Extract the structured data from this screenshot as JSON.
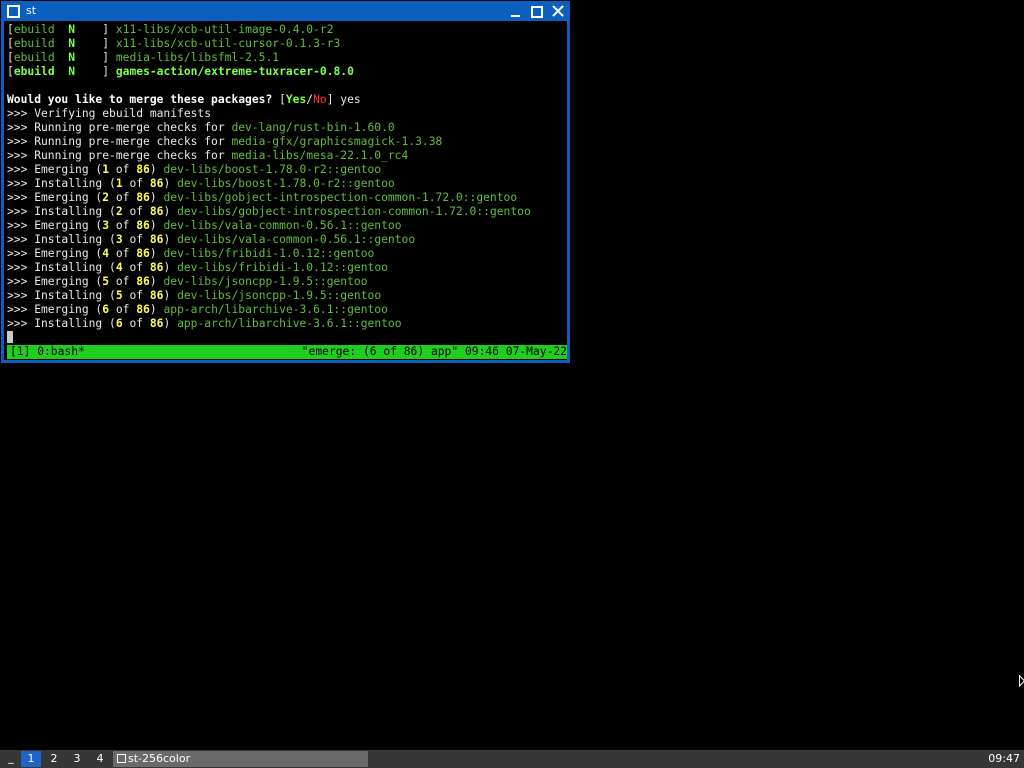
{
  "window": {
    "title": "st",
    "minimize_icon": "minimize-icon",
    "maximize_icon": "maximize-icon",
    "close_icon": "close-icon"
  },
  "terminal": {
    "lines": [
      [
        {
          "t": "[",
          "c": ""
        },
        {
          "t": "ebuild",
          "c": "g"
        },
        {
          "t": "  ",
          "c": ""
        },
        {
          "t": "N",
          "c": "gb"
        },
        {
          "t": "    ] ",
          "c": ""
        },
        {
          "t": "x11-libs/xcb-util-image-0.4.0-r2",
          "c": "g"
        }
      ],
      [
        {
          "t": "[",
          "c": ""
        },
        {
          "t": "ebuild",
          "c": "g"
        },
        {
          "t": "  ",
          "c": ""
        },
        {
          "t": "N",
          "c": "gb"
        },
        {
          "t": "    ] ",
          "c": ""
        },
        {
          "t": "x11-libs/xcb-util-cursor-0.1.3-r3",
          "c": "g"
        }
      ],
      [
        {
          "t": "[",
          "c": ""
        },
        {
          "t": "ebuild",
          "c": "g"
        },
        {
          "t": "  ",
          "c": ""
        },
        {
          "t": "N",
          "c": "gb"
        },
        {
          "t": "    ] ",
          "c": ""
        },
        {
          "t": "media-libs/libsfml-2.5.1",
          "c": "g"
        }
      ],
      [
        {
          "t": "[",
          "c": ""
        },
        {
          "t": "ebuild",
          "c": "gb"
        },
        {
          "t": "  ",
          "c": ""
        },
        {
          "t": "N",
          "c": "gb"
        },
        {
          "t": "    ] ",
          "c": ""
        },
        {
          "t": "games-action/extreme-tuxracer-0.8.0",
          "c": "gb"
        }
      ],
      [
        {
          "t": "",
          "c": ""
        }
      ],
      [
        {
          "t": "Would you like to merge these packages?",
          "c": "w"
        },
        {
          "t": " [",
          "c": ""
        },
        {
          "t": "Yes",
          "c": "gb"
        },
        {
          "t": "/",
          "c": ""
        },
        {
          "t": "No",
          "c": "r"
        },
        {
          "t": "] yes",
          "c": ""
        }
      ],
      [
        {
          "t": ">>> Verifying ebuild manifests",
          "c": ""
        }
      ],
      [
        {
          "t": ">>> Running pre-merge checks for ",
          "c": ""
        },
        {
          "t": "dev-lang/rust-bin-1.60.0",
          "c": "g"
        }
      ],
      [
        {
          "t": ">>> Running pre-merge checks for ",
          "c": ""
        },
        {
          "t": "media-gfx/graphicsmagick-1.3.38",
          "c": "g"
        }
      ],
      [
        {
          "t": ">>> Running pre-merge checks for ",
          "c": ""
        },
        {
          "t": "media-libs/mesa-22.1.0_rc4",
          "c": "g"
        }
      ],
      [
        {
          "t": ">>> Emerging (",
          "c": ""
        },
        {
          "t": "1",
          "c": "y"
        },
        {
          "t": " of ",
          "c": ""
        },
        {
          "t": "86",
          "c": "y"
        },
        {
          "t": ") ",
          "c": ""
        },
        {
          "t": "dev-libs/boost-1.78.0-r2::gentoo",
          "c": "g"
        }
      ],
      [
        {
          "t": ">>> Installing (",
          "c": ""
        },
        {
          "t": "1",
          "c": "y"
        },
        {
          "t": " of ",
          "c": ""
        },
        {
          "t": "86",
          "c": "y"
        },
        {
          "t": ") ",
          "c": ""
        },
        {
          "t": "dev-libs/boost-1.78.0-r2::gentoo",
          "c": "g"
        }
      ],
      [
        {
          "t": ">>> Emerging (",
          "c": ""
        },
        {
          "t": "2",
          "c": "y"
        },
        {
          "t": " of ",
          "c": ""
        },
        {
          "t": "86",
          "c": "y"
        },
        {
          "t": ") ",
          "c": ""
        },
        {
          "t": "dev-libs/gobject-introspection-common-1.72.0::gentoo",
          "c": "g"
        }
      ],
      [
        {
          "t": ">>> Installing (",
          "c": ""
        },
        {
          "t": "2",
          "c": "y"
        },
        {
          "t": " of ",
          "c": ""
        },
        {
          "t": "86",
          "c": "y"
        },
        {
          "t": ") ",
          "c": ""
        },
        {
          "t": "dev-libs/gobject-introspection-common-1.72.0::gentoo",
          "c": "g"
        }
      ],
      [
        {
          "t": ">>> Emerging (",
          "c": ""
        },
        {
          "t": "3",
          "c": "y"
        },
        {
          "t": " of ",
          "c": ""
        },
        {
          "t": "86",
          "c": "y"
        },
        {
          "t": ") ",
          "c": ""
        },
        {
          "t": "dev-libs/vala-common-0.56.1::gentoo",
          "c": "g"
        }
      ],
      [
        {
          "t": ">>> Installing (",
          "c": ""
        },
        {
          "t": "3",
          "c": "y"
        },
        {
          "t": " of ",
          "c": ""
        },
        {
          "t": "86",
          "c": "y"
        },
        {
          "t": ") ",
          "c": ""
        },
        {
          "t": "dev-libs/vala-common-0.56.1::gentoo",
          "c": "g"
        }
      ],
      [
        {
          "t": ">>> Emerging (",
          "c": ""
        },
        {
          "t": "4",
          "c": "y"
        },
        {
          "t": " of ",
          "c": ""
        },
        {
          "t": "86",
          "c": "y"
        },
        {
          "t": ") ",
          "c": ""
        },
        {
          "t": "dev-libs/fribidi-1.0.12::gentoo",
          "c": "g"
        }
      ],
      [
        {
          "t": ">>> Installing (",
          "c": ""
        },
        {
          "t": "4",
          "c": "y"
        },
        {
          "t": " of ",
          "c": ""
        },
        {
          "t": "86",
          "c": "y"
        },
        {
          "t": ") ",
          "c": ""
        },
        {
          "t": "dev-libs/fribidi-1.0.12::gentoo",
          "c": "g"
        }
      ],
      [
        {
          "t": ">>> Emerging (",
          "c": ""
        },
        {
          "t": "5",
          "c": "y"
        },
        {
          "t": " of ",
          "c": ""
        },
        {
          "t": "86",
          "c": "y"
        },
        {
          "t": ") ",
          "c": ""
        },
        {
          "t": "dev-libs/jsoncpp-1.9.5::gentoo",
          "c": "g"
        }
      ],
      [
        {
          "t": ">>> Installing (",
          "c": ""
        },
        {
          "t": "5",
          "c": "y"
        },
        {
          "t": " of ",
          "c": ""
        },
        {
          "t": "86",
          "c": "y"
        },
        {
          "t": ") ",
          "c": ""
        },
        {
          "t": "dev-libs/jsoncpp-1.9.5::gentoo",
          "c": "g"
        }
      ],
      [
        {
          "t": ">>> Emerging (",
          "c": ""
        },
        {
          "t": "6",
          "c": "y"
        },
        {
          "t": " of ",
          "c": ""
        },
        {
          "t": "86",
          "c": "y"
        },
        {
          "t": ") ",
          "c": ""
        },
        {
          "t": "app-arch/libarchive-3.6.1::gentoo",
          "c": "g"
        }
      ],
      [
        {
          "t": ">>> Installing (",
          "c": ""
        },
        {
          "t": "6",
          "c": "y"
        },
        {
          "t": " of ",
          "c": ""
        },
        {
          "t": "86",
          "c": "y"
        },
        {
          "t": ") ",
          "c": ""
        },
        {
          "t": "app-arch/libarchive-3.6.1::gentoo",
          "c": "g"
        }
      ]
    ]
  },
  "tmux": {
    "left": "[1] 0:bash*",
    "right": "\"emerge: (6 of 86) app\" 09:46 07-May-22"
  },
  "taskbar": {
    "launcher": "_",
    "workspaces": [
      "1",
      "2",
      "3",
      "4"
    ],
    "active_workspace": "1",
    "task_label": "st-256color",
    "clock": "09:47"
  },
  "colors": {
    "titlebar": "#0a5fbf",
    "tmux_bar": "#1fcf1f",
    "package_green": "#5fbf3a",
    "highlight_yellow": "#ffff55",
    "no_red": "#ff3030",
    "taskbar": "#363636",
    "active_workspace": "#1e63c6"
  }
}
